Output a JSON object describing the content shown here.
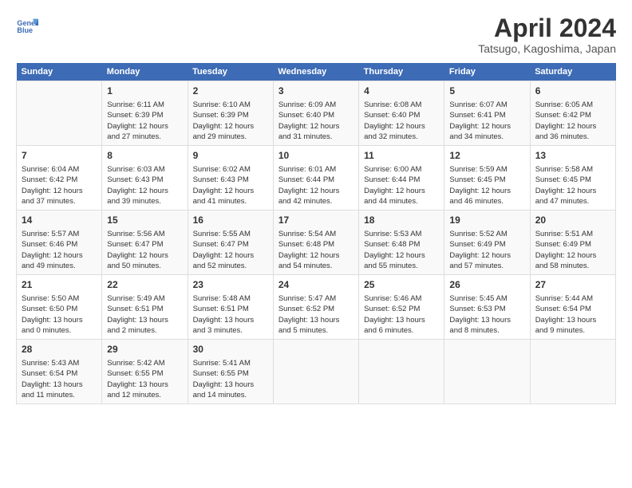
{
  "logo": {
    "line1": "General",
    "line2": "Blue"
  },
  "title": "April 2024",
  "location": "Tatsugo, Kagoshima, Japan",
  "days_header": [
    "Sunday",
    "Monday",
    "Tuesday",
    "Wednesday",
    "Thursday",
    "Friday",
    "Saturday"
  ],
  "weeks": [
    [
      {
        "day": "",
        "info": ""
      },
      {
        "day": "1",
        "info": "Sunrise: 6:11 AM\nSunset: 6:39 PM\nDaylight: 12 hours\nand 27 minutes."
      },
      {
        "day": "2",
        "info": "Sunrise: 6:10 AM\nSunset: 6:39 PM\nDaylight: 12 hours\nand 29 minutes."
      },
      {
        "day": "3",
        "info": "Sunrise: 6:09 AM\nSunset: 6:40 PM\nDaylight: 12 hours\nand 31 minutes."
      },
      {
        "day": "4",
        "info": "Sunrise: 6:08 AM\nSunset: 6:40 PM\nDaylight: 12 hours\nand 32 minutes."
      },
      {
        "day": "5",
        "info": "Sunrise: 6:07 AM\nSunset: 6:41 PM\nDaylight: 12 hours\nand 34 minutes."
      },
      {
        "day": "6",
        "info": "Sunrise: 6:05 AM\nSunset: 6:42 PM\nDaylight: 12 hours\nand 36 minutes."
      }
    ],
    [
      {
        "day": "7",
        "info": "Sunrise: 6:04 AM\nSunset: 6:42 PM\nDaylight: 12 hours\nand 37 minutes."
      },
      {
        "day": "8",
        "info": "Sunrise: 6:03 AM\nSunset: 6:43 PM\nDaylight: 12 hours\nand 39 minutes."
      },
      {
        "day": "9",
        "info": "Sunrise: 6:02 AM\nSunset: 6:43 PM\nDaylight: 12 hours\nand 41 minutes."
      },
      {
        "day": "10",
        "info": "Sunrise: 6:01 AM\nSunset: 6:44 PM\nDaylight: 12 hours\nand 42 minutes."
      },
      {
        "day": "11",
        "info": "Sunrise: 6:00 AM\nSunset: 6:44 PM\nDaylight: 12 hours\nand 44 minutes."
      },
      {
        "day": "12",
        "info": "Sunrise: 5:59 AM\nSunset: 6:45 PM\nDaylight: 12 hours\nand 46 minutes."
      },
      {
        "day": "13",
        "info": "Sunrise: 5:58 AM\nSunset: 6:45 PM\nDaylight: 12 hours\nand 47 minutes."
      }
    ],
    [
      {
        "day": "14",
        "info": "Sunrise: 5:57 AM\nSunset: 6:46 PM\nDaylight: 12 hours\nand 49 minutes."
      },
      {
        "day": "15",
        "info": "Sunrise: 5:56 AM\nSunset: 6:47 PM\nDaylight: 12 hours\nand 50 minutes."
      },
      {
        "day": "16",
        "info": "Sunrise: 5:55 AM\nSunset: 6:47 PM\nDaylight: 12 hours\nand 52 minutes."
      },
      {
        "day": "17",
        "info": "Sunrise: 5:54 AM\nSunset: 6:48 PM\nDaylight: 12 hours\nand 54 minutes."
      },
      {
        "day": "18",
        "info": "Sunrise: 5:53 AM\nSunset: 6:48 PM\nDaylight: 12 hours\nand 55 minutes."
      },
      {
        "day": "19",
        "info": "Sunrise: 5:52 AM\nSunset: 6:49 PM\nDaylight: 12 hours\nand 57 minutes."
      },
      {
        "day": "20",
        "info": "Sunrise: 5:51 AM\nSunset: 6:49 PM\nDaylight: 12 hours\nand 58 minutes."
      }
    ],
    [
      {
        "day": "21",
        "info": "Sunrise: 5:50 AM\nSunset: 6:50 PM\nDaylight: 13 hours\nand 0 minutes."
      },
      {
        "day": "22",
        "info": "Sunrise: 5:49 AM\nSunset: 6:51 PM\nDaylight: 13 hours\nand 2 minutes."
      },
      {
        "day": "23",
        "info": "Sunrise: 5:48 AM\nSunset: 6:51 PM\nDaylight: 13 hours\nand 3 minutes."
      },
      {
        "day": "24",
        "info": "Sunrise: 5:47 AM\nSunset: 6:52 PM\nDaylight: 13 hours\nand 5 minutes."
      },
      {
        "day": "25",
        "info": "Sunrise: 5:46 AM\nSunset: 6:52 PM\nDaylight: 13 hours\nand 6 minutes."
      },
      {
        "day": "26",
        "info": "Sunrise: 5:45 AM\nSunset: 6:53 PM\nDaylight: 13 hours\nand 8 minutes."
      },
      {
        "day": "27",
        "info": "Sunrise: 5:44 AM\nSunset: 6:54 PM\nDaylight: 13 hours\nand 9 minutes."
      }
    ],
    [
      {
        "day": "28",
        "info": "Sunrise: 5:43 AM\nSunset: 6:54 PM\nDaylight: 13 hours\nand 11 minutes."
      },
      {
        "day": "29",
        "info": "Sunrise: 5:42 AM\nSunset: 6:55 PM\nDaylight: 13 hours\nand 12 minutes."
      },
      {
        "day": "30",
        "info": "Sunrise: 5:41 AM\nSunset: 6:55 PM\nDaylight: 13 hours\nand 14 minutes."
      },
      {
        "day": "",
        "info": ""
      },
      {
        "day": "",
        "info": ""
      },
      {
        "day": "",
        "info": ""
      },
      {
        "day": "",
        "info": ""
      }
    ]
  ]
}
